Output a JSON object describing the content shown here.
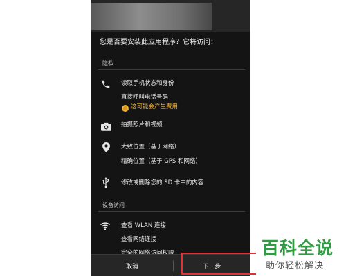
{
  "dialog": {
    "title": "您是否要安装此应用程序？它将访问："
  },
  "sections": {
    "privacy": "隐私",
    "device_access": "设备访问"
  },
  "permissions": {
    "phone_state": "读取手机状态和身份",
    "call_phone": "直接呼叫电话号码",
    "cost_warning": "这可能会产生费用",
    "camera": "拍摄照片和视频",
    "coarse_location": "大致位置（基于网络）",
    "fine_location": "精确位置（基于 GPS 和网络）",
    "sd_card": "修改或删除您的 SD 卡中的内容",
    "wlan": "查看 WLAN 连接",
    "network": "查看网络连接",
    "full_network": "完全的网络访问权限"
  },
  "buttons": {
    "cancel": "取消",
    "next": "下一步"
  },
  "watermark": {
    "line1": "百科全说",
    "line2": "助你轻松解决"
  },
  "icons": {
    "phone": "phone-icon",
    "camera": "camera-icon",
    "location": "location-pin-icon",
    "usb": "usb-icon",
    "wifi": "wifi-icon",
    "coin": "coin-icon"
  },
  "colors": {
    "screen_bg": "#141414",
    "warning": "#f1b23a",
    "highlight": "#e33035",
    "watermark_green": "#2f9c43"
  }
}
